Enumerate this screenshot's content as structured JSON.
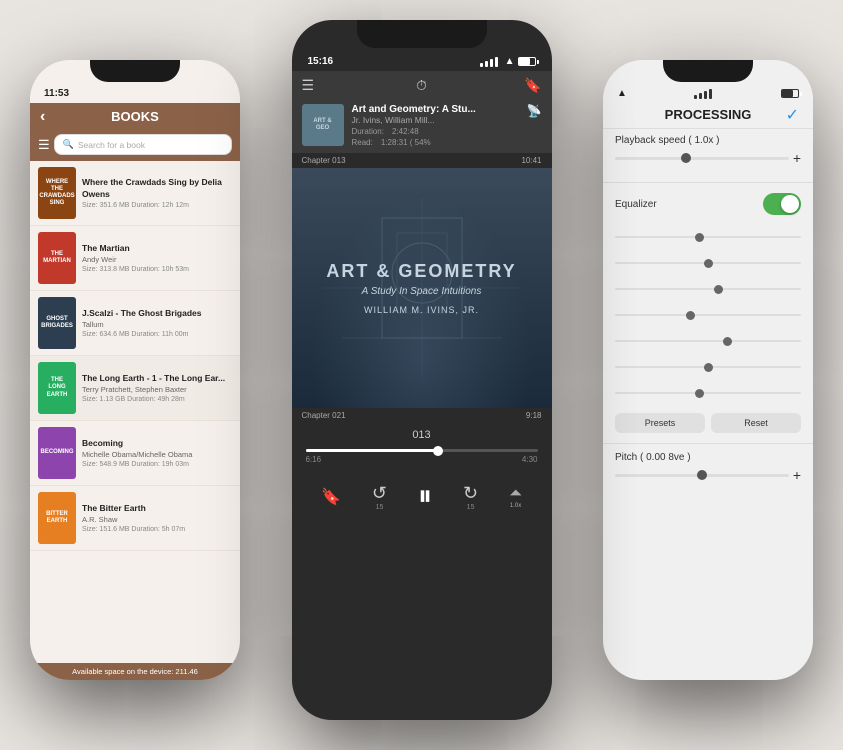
{
  "leftPhone": {
    "statusBar": {
      "time": "11:53"
    },
    "header": {
      "title": "BOOKS",
      "backLabel": "‹"
    },
    "search": {
      "placeholder": "Search for a book"
    },
    "books": [
      {
        "id": 1,
        "title": "Where the Crawdads Sing by Delia Owens",
        "author": "Delia Owens",
        "meta": "Size: 351.6 MB  Duration: 12h 12m",
        "coverColor": "#8B4513",
        "coverText": "WHERE THE CRAWDADS SING"
      },
      {
        "id": 2,
        "title": "The Martian",
        "author": "Andy Weir",
        "meta": "Size: 313.8 MB  Duration: 10h 53m",
        "coverColor": "#c0392b",
        "coverText": "THE MARTIAN"
      },
      {
        "id": 3,
        "title": "J.Scalzi - The Ghost Brigades",
        "author": "Tallum",
        "meta": "Size: 634.6 MB  Duration: 11h 00m",
        "coverColor": "#2c3e50",
        "coverText": "GHOST BRIGADES"
      },
      {
        "id": 4,
        "title": "The Long Earth - 1 - The Long Ear...",
        "author": "Terry Pratchett, Stephen Baxter",
        "meta": "Size: 1.13 GB  Duration: 49h 28m",
        "coverColor": "#27ae60",
        "coverText": "THE LONG EARTH"
      },
      {
        "id": 5,
        "title": "Becoming",
        "author": "Michelle Obama/Michelle Obama",
        "meta": "Size: 548.9 MB  Duration: 19h 03m",
        "coverColor": "#8e44ad",
        "coverText": "BECOMING"
      },
      {
        "id": 6,
        "title": "The Bitter Earth",
        "author": "A.R. Shaw",
        "meta": "Size: 151.6 MB  Duration: 5h 07m",
        "coverColor": "#e67e22",
        "coverText": "BITTER EARTH"
      }
    ],
    "storageBar": "Available space on the device: 211.46"
  },
  "centerPhone": {
    "statusBar": {
      "time": "15:16",
      "hasArrow": true
    },
    "nowPlaying": {
      "title": "Art and Geometry: A Stu...",
      "author": "Jr. Ivins, William Mill...",
      "durationLabel": "Duration:",
      "duration": "2:42:48",
      "readLabel": "Read:",
      "readProgress": "1:28:31 ( 54%"
    },
    "chapterTop": "Chapter 013",
    "chapterTopTime": "10:41",
    "albumArt": {
      "title": "ART & GEOMETRY",
      "subtitle": "A Study In Space Intuitions",
      "author": "WILLIAM M. IVINS, JR."
    },
    "chapterBottom": "Chapter 021",
    "chapterBottomTime": "9:18",
    "trackNum": "013",
    "progress": {
      "fill": 58,
      "elapsed": "6:16",
      "remaining": "4:30"
    },
    "controls": {
      "bookmark": "🔖",
      "rewind": "↺",
      "pause": "⏸",
      "forward": "↻",
      "eq": "≡"
    }
  },
  "rightPhone": {
    "statusBar": {
      "timeHidden": true
    },
    "header": {
      "title": "PROCESSING",
      "checkmark": "✓"
    },
    "playbackSpeed": {
      "label": "Playback speed ( 1.0x )",
      "sliderPos": 40,
      "plusLabel": "+"
    },
    "equalizer": {
      "label": "Equalizer",
      "enabled": true
    },
    "eqBands": [
      {
        "pos": 45
      },
      {
        "pos": 50
      },
      {
        "pos": 55
      },
      {
        "pos": 40
      },
      {
        "pos": 60
      },
      {
        "pos": 50
      },
      {
        "pos": 45
      }
    ],
    "buttons": {
      "presets": "Presets",
      "reset": "Reset"
    },
    "pitch": {
      "label": "Pitch ( 0.00 8ve )",
      "sliderPos": 50,
      "plusLabel": "+"
    }
  }
}
